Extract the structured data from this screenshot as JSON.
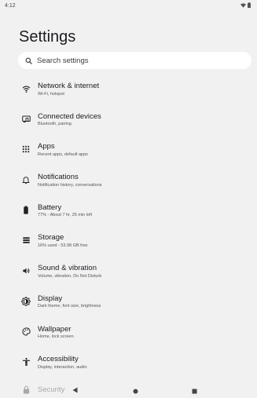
{
  "status_bar": {
    "time": "4:12"
  },
  "header": {
    "title": "Settings"
  },
  "search": {
    "placeholder": "Search settings"
  },
  "items": [
    {
      "title": "Network & internet",
      "subtitle": "Wi-Fi, hotspot",
      "icon": "wifi-icon"
    },
    {
      "title": "Connected devices",
      "subtitle": "Bluetooth, pairing",
      "icon": "devices-icon"
    },
    {
      "title": "Apps",
      "subtitle": "Recent apps, default apps",
      "icon": "apps-grid-icon"
    },
    {
      "title": "Notifications",
      "subtitle": "Notification history, conversations",
      "icon": "bell-icon"
    },
    {
      "title": "Battery",
      "subtitle": "77% - About 7 hr, 25 min left",
      "icon": "battery-icon"
    },
    {
      "title": "Storage",
      "subtitle": "16% used - 53.98 GB free",
      "icon": "storage-icon"
    },
    {
      "title": "Sound & vibration",
      "subtitle": "Volume, vibration, Do Not Disturb",
      "icon": "volume-icon"
    },
    {
      "title": "Display",
      "subtitle": "Dark theme, font size, brightness",
      "icon": "brightness-icon"
    },
    {
      "title": "Wallpaper",
      "subtitle": "Home, lock screen",
      "icon": "palette-icon"
    },
    {
      "title": "Accessibility",
      "subtitle": "Display, interaction, audio",
      "icon": "accessibility-icon"
    }
  ],
  "partial_item": {
    "title": "Security",
    "icon": "lock-icon"
  },
  "nav_bar": {
    "back": "back-icon",
    "home": "home-icon",
    "recents": "recents-icon"
  }
}
